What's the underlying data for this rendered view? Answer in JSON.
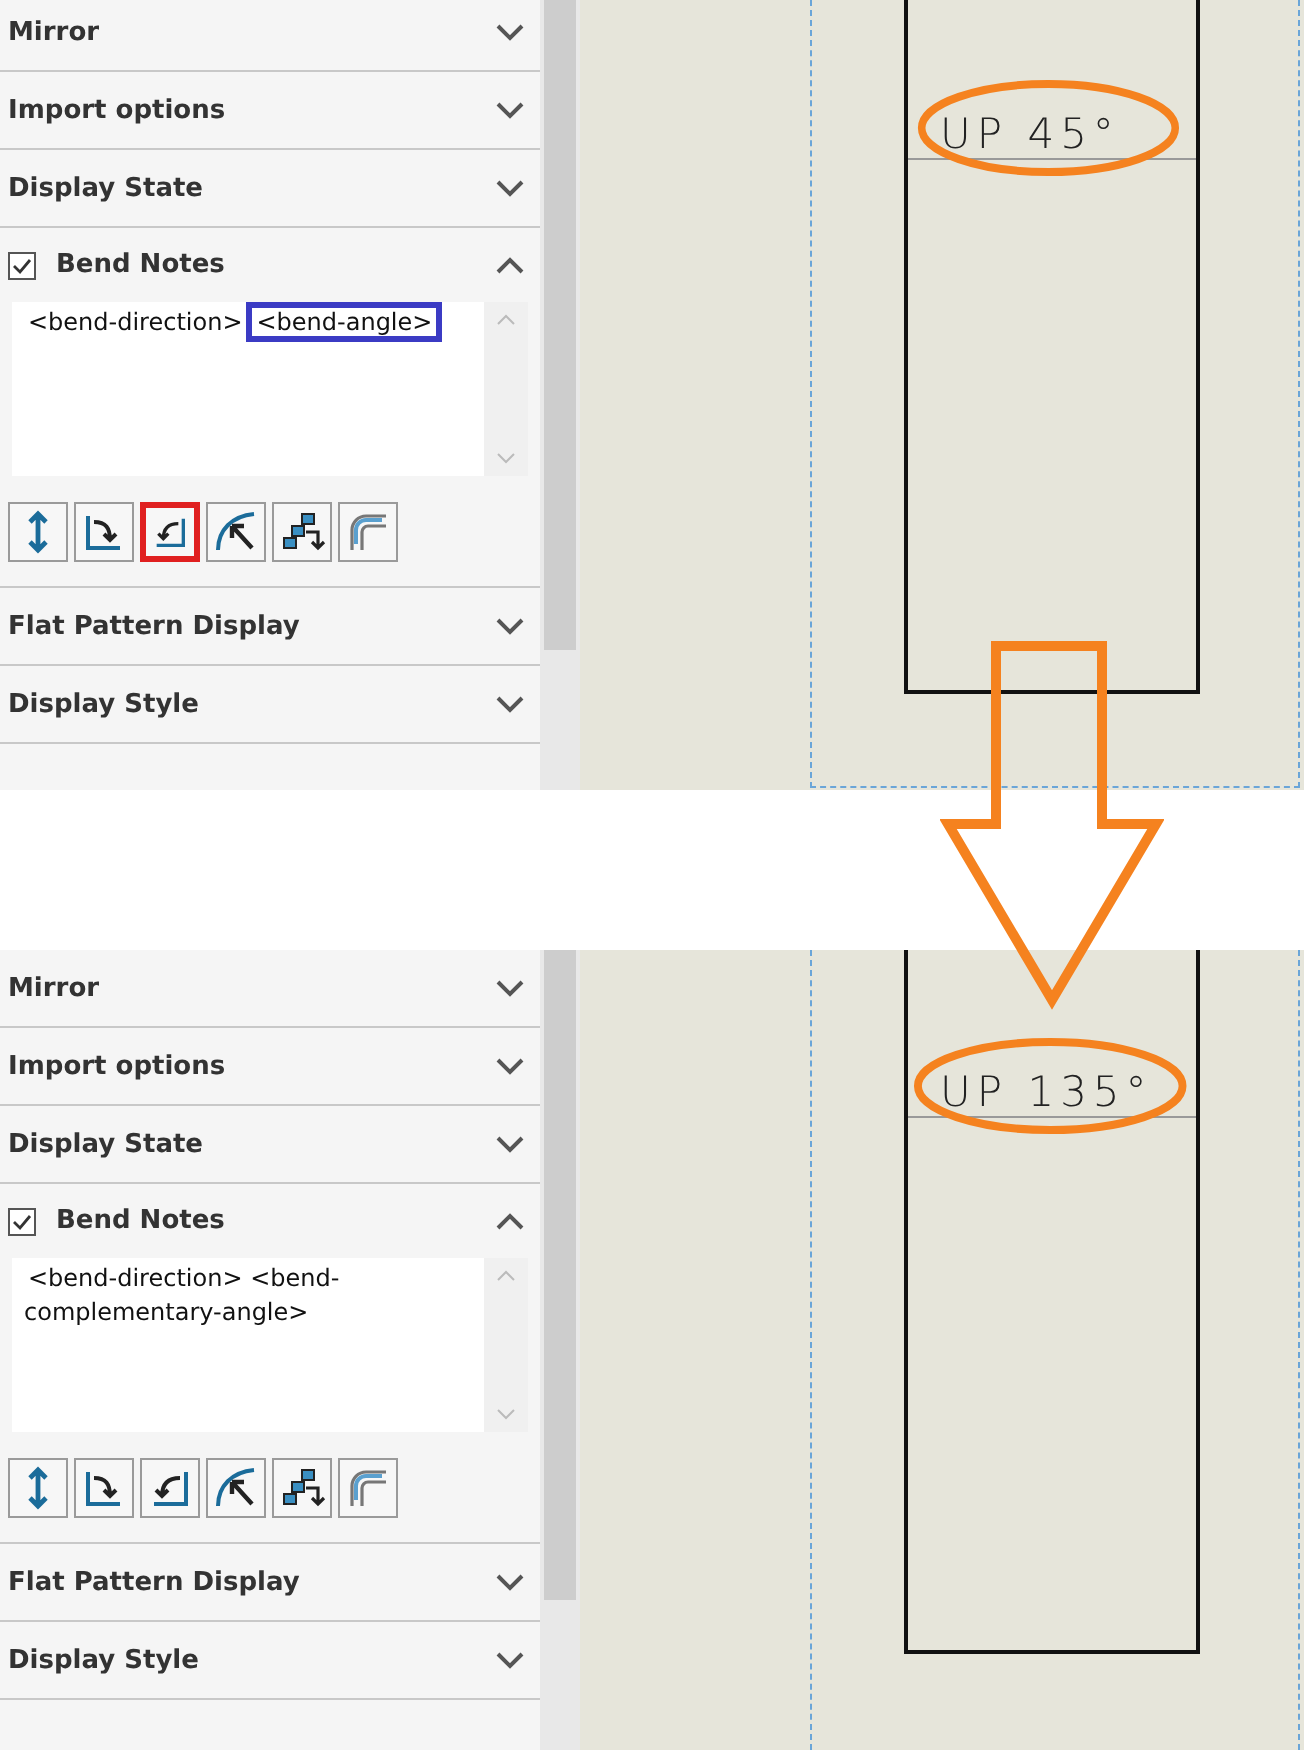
{
  "shots": [
    {
      "sections_before": [
        {
          "label": "Mirror",
          "expanded": false
        },
        {
          "label": "Import options",
          "expanded": false
        },
        {
          "label": "Display State",
          "expanded": false
        }
      ],
      "bend_notes": {
        "label": "Bend Notes",
        "checked": true,
        "expanded": true,
        "segments": [
          {
            "text": "<bend-direction>",
            "selected": false
          },
          {
            "text": "<bend-angle>",
            "selected": true
          }
        ],
        "tools": [
          {
            "kind": "direction",
            "selected": false
          },
          {
            "kind": "smaller",
            "selected": false
          },
          {
            "kind": "complement",
            "selected": true
          },
          {
            "kind": "radius",
            "selected": false
          },
          {
            "kind": "order",
            "selected": false
          },
          {
            "kind": "area",
            "selected": false
          }
        ]
      },
      "sections_after": [
        {
          "label": "Flat Pattern Display",
          "expanded": false
        },
        {
          "label": "Display Style",
          "expanded": false
        }
      ],
      "note_label": "UP 45°"
    },
    {
      "sections_before": [
        {
          "label": "Mirror",
          "expanded": false
        },
        {
          "label": "Import options",
          "expanded": false
        },
        {
          "label": "Display State",
          "expanded": false
        }
      ],
      "bend_notes": {
        "label": "Bend Notes",
        "checked": true,
        "expanded": true,
        "segments": [
          {
            "text": "<bend-direction> <bend-complementary-angle>",
            "selected": false
          }
        ],
        "tools": [
          {
            "kind": "direction",
            "selected": false
          },
          {
            "kind": "smaller",
            "selected": false
          },
          {
            "kind": "complement",
            "selected": false
          },
          {
            "kind": "radius",
            "selected": false
          },
          {
            "kind": "order",
            "selected": false
          },
          {
            "kind": "area",
            "selected": false
          }
        ]
      },
      "sections_after": [
        {
          "label": "Flat Pattern Display",
          "expanded": false
        },
        {
          "label": "Display Style",
          "expanded": false
        }
      ],
      "note_label": "UP 135°"
    }
  ]
}
